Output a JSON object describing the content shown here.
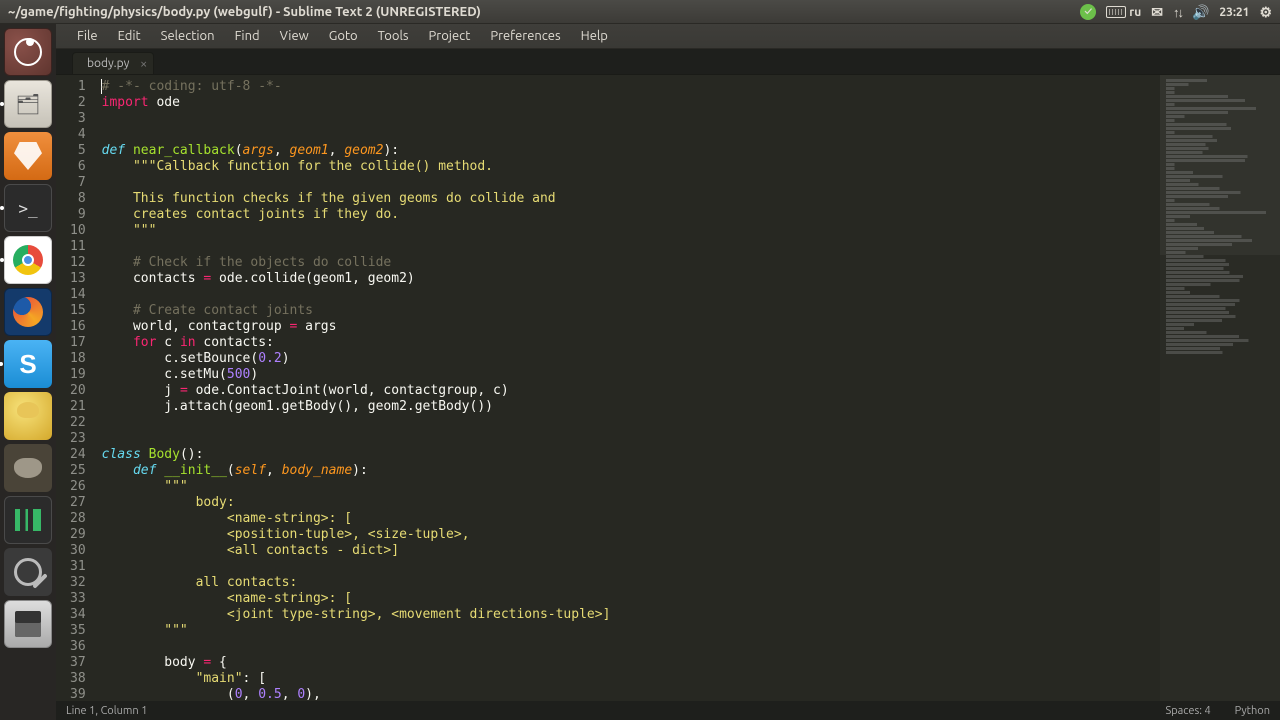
{
  "window": {
    "title": "~/game/fighting/physics/body.py (webgulf) - Sublime Text 2 (UNREGISTERED)"
  },
  "system": {
    "keyboard_layout": "ru",
    "time": "23:21"
  },
  "menu": {
    "items": [
      "File",
      "Edit",
      "Selection",
      "Find",
      "View",
      "Goto",
      "Tools",
      "Project",
      "Preferences",
      "Help"
    ]
  },
  "tabs": [
    {
      "label": "body.py"
    }
  ],
  "status": {
    "position": "Line 1, Column 1",
    "spaces": "Spaces: 4",
    "syntax": "Python"
  },
  "code": {
    "lines": [
      {
        "n": 1,
        "tokens": [
          [
            "c-comment",
            "# -*- coding: utf-8 -*-"
          ]
        ]
      },
      {
        "n": 2,
        "tokens": [
          [
            "c-keyword",
            "import"
          ],
          [
            "c-default",
            " ode"
          ]
        ]
      },
      {
        "n": 3,
        "tokens": []
      },
      {
        "n": 4,
        "tokens": []
      },
      {
        "n": 5,
        "tokens": [
          [
            "c-storage",
            "def"
          ],
          [
            "c-default",
            " "
          ],
          [
            "c-funcname",
            "near_callback"
          ],
          [
            "c-default",
            "("
          ],
          [
            "c-param",
            "args"
          ],
          [
            "c-default",
            ", "
          ],
          [
            "c-param",
            "geom1"
          ],
          [
            "c-default",
            ", "
          ],
          [
            "c-param",
            "geom2"
          ],
          [
            "c-default",
            "):"
          ]
        ]
      },
      {
        "n": 6,
        "tokens": [
          [
            "c-default",
            "    "
          ],
          [
            "c-doc",
            "\"\"\"Callback function for the collide() method."
          ]
        ]
      },
      {
        "n": 7,
        "tokens": []
      },
      {
        "n": 8,
        "tokens": [
          [
            "c-default",
            "    "
          ],
          [
            "c-doc",
            "This function checks if the given geoms do collide and"
          ]
        ]
      },
      {
        "n": 9,
        "tokens": [
          [
            "c-default",
            "    "
          ],
          [
            "c-doc",
            "creates contact joints if they do."
          ]
        ]
      },
      {
        "n": 10,
        "tokens": [
          [
            "c-default",
            "    "
          ],
          [
            "c-doc",
            "\"\"\""
          ]
        ]
      },
      {
        "n": 11,
        "tokens": []
      },
      {
        "n": 12,
        "tokens": [
          [
            "c-default",
            "    "
          ],
          [
            "c-comment",
            "# Check if the objects do collide"
          ]
        ]
      },
      {
        "n": 13,
        "tokens": [
          [
            "c-default",
            "    contacts "
          ],
          [
            "c-op",
            "="
          ],
          [
            "c-default",
            " ode.collide(geom1, geom2)"
          ]
        ]
      },
      {
        "n": 14,
        "tokens": []
      },
      {
        "n": 15,
        "tokens": [
          [
            "c-default",
            "    "
          ],
          [
            "c-comment",
            "# Create contact joints"
          ]
        ]
      },
      {
        "n": 16,
        "tokens": [
          [
            "c-default",
            "    world, contactgroup "
          ],
          [
            "c-op",
            "="
          ],
          [
            "c-default",
            " args"
          ]
        ]
      },
      {
        "n": 17,
        "tokens": [
          [
            "c-default",
            "    "
          ],
          [
            "c-keyword",
            "for"
          ],
          [
            "c-default",
            " c "
          ],
          [
            "c-keyword",
            "in"
          ],
          [
            "c-default",
            " contacts:"
          ]
        ]
      },
      {
        "n": 18,
        "tokens": [
          [
            "c-default",
            "        c.setBounce("
          ],
          [
            "c-number",
            "0.2"
          ],
          [
            "c-default",
            ")"
          ]
        ]
      },
      {
        "n": 19,
        "tokens": [
          [
            "c-default",
            "        c.setMu("
          ],
          [
            "c-number",
            "500"
          ],
          [
            "c-default",
            ")"
          ]
        ]
      },
      {
        "n": 20,
        "tokens": [
          [
            "c-default",
            "        j "
          ],
          [
            "c-op",
            "="
          ],
          [
            "c-default",
            " ode.ContactJoint(world, contactgroup, c)"
          ]
        ]
      },
      {
        "n": 21,
        "tokens": [
          [
            "c-default",
            "        j.attach(geom1.getBody(), geom2.getBody())"
          ]
        ]
      },
      {
        "n": 22,
        "tokens": []
      },
      {
        "n": 23,
        "tokens": []
      },
      {
        "n": 24,
        "tokens": [
          [
            "c-storage",
            "class"
          ],
          [
            "c-default",
            " "
          ],
          [
            "c-classname",
            "Body"
          ],
          [
            "c-default",
            "():"
          ]
        ]
      },
      {
        "n": 25,
        "tokens": [
          [
            "c-default",
            "    "
          ],
          [
            "c-storage",
            "def"
          ],
          [
            "c-default",
            " "
          ],
          [
            "c-funcname",
            "__init__"
          ],
          [
            "c-default",
            "("
          ],
          [
            "c-selfparam",
            "self"
          ],
          [
            "c-default",
            ", "
          ],
          [
            "c-param",
            "body_name"
          ],
          [
            "c-default",
            "):"
          ]
        ]
      },
      {
        "n": 26,
        "tokens": [
          [
            "c-default",
            "        "
          ],
          [
            "c-doc",
            "\"\"\""
          ]
        ]
      },
      {
        "n": 27,
        "tokens": [
          [
            "c-default",
            "            "
          ],
          [
            "c-doc",
            "body:"
          ]
        ]
      },
      {
        "n": 28,
        "tokens": [
          [
            "c-default",
            "                "
          ],
          [
            "c-doc",
            "<name-string>: ["
          ]
        ]
      },
      {
        "n": 29,
        "tokens": [
          [
            "c-default",
            "                "
          ],
          [
            "c-doc",
            "<position-tuple>, <size-tuple>,"
          ]
        ]
      },
      {
        "n": 30,
        "tokens": [
          [
            "c-default",
            "                "
          ],
          [
            "c-doc",
            "<all contacts - dict>]"
          ]
        ]
      },
      {
        "n": 31,
        "tokens": []
      },
      {
        "n": 32,
        "tokens": [
          [
            "c-default",
            "            "
          ],
          [
            "c-doc",
            "all contacts:"
          ]
        ]
      },
      {
        "n": 33,
        "tokens": [
          [
            "c-default",
            "                "
          ],
          [
            "c-doc",
            "<name-string>: ["
          ]
        ]
      },
      {
        "n": 34,
        "tokens": [
          [
            "c-default",
            "                "
          ],
          [
            "c-doc",
            "<joint type-string>, <movement directions-tuple>]"
          ]
        ]
      },
      {
        "n": 35,
        "tokens": [
          [
            "c-default",
            "        "
          ],
          [
            "c-doc",
            "\"\"\""
          ]
        ]
      },
      {
        "n": 36,
        "tokens": []
      },
      {
        "n": 37,
        "tokens": [
          [
            "c-default",
            "        body "
          ],
          [
            "c-op",
            "="
          ],
          [
            "c-default",
            " {"
          ]
        ]
      },
      {
        "n": 38,
        "tokens": [
          [
            "c-default",
            "            "
          ],
          [
            "c-string",
            "\"main\""
          ],
          [
            "c-default",
            ": ["
          ]
        ]
      },
      {
        "n": 39,
        "tokens": [
          [
            "c-default",
            "                ("
          ],
          [
            "c-number",
            "0"
          ],
          [
            "c-default",
            ", "
          ],
          [
            "c-number",
            "0.5"
          ],
          [
            "c-default",
            ", "
          ],
          [
            "c-number",
            "0"
          ],
          [
            "c-default",
            "),"
          ]
        ]
      }
    ]
  }
}
